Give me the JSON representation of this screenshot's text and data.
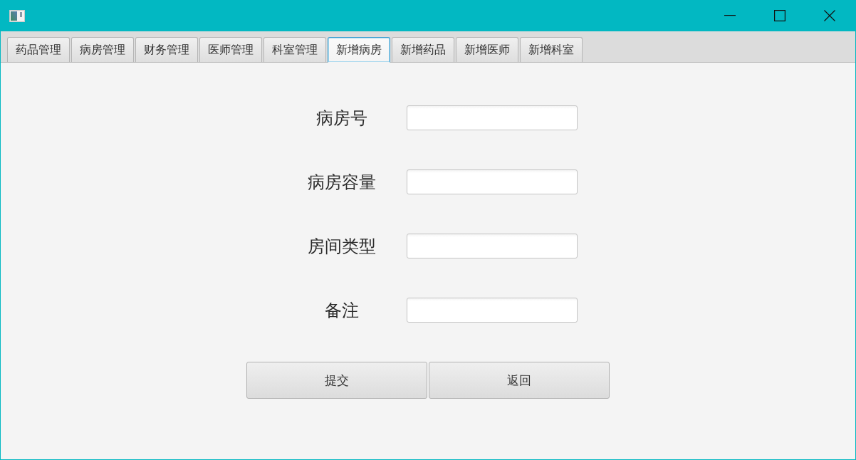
{
  "window": {
    "controls": [
      {
        "kind": "minimize"
      },
      {
        "kind": "maximize"
      },
      {
        "kind": "close"
      }
    ]
  },
  "tabs": [
    {
      "label": "药品管理",
      "selected": false
    },
    {
      "label": "病房管理",
      "selected": false
    },
    {
      "label": "财务管理",
      "selected": false
    },
    {
      "label": "医师管理",
      "selected": false
    },
    {
      "label": "科室管理",
      "selected": false
    },
    {
      "label": "新增病房",
      "selected": true
    },
    {
      "label": "新增药品",
      "selected": false
    },
    {
      "label": "新增医师",
      "selected": false
    },
    {
      "label": "新增科室",
      "selected": false
    }
  ],
  "form": {
    "fields": [
      {
        "label": "病房号"
      },
      {
        "label": "病房容量"
      },
      {
        "label": "房间类型"
      },
      {
        "label": "备注"
      }
    ],
    "buttons": [
      "提交",
      "返回"
    ]
  }
}
